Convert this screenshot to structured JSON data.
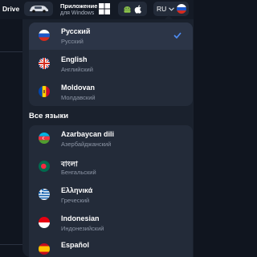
{
  "topbar": {
    "drive_label": "Drive",
    "app_title": "Приложение",
    "app_subtitle": "для Windows",
    "current_lang": "RU"
  },
  "top_languages": [
    {
      "name": "Русский",
      "native": "Русский",
      "flag": "ru-flag-icon",
      "selected": true
    },
    {
      "name": "English",
      "native": "Английский",
      "flag": "gb-flag-icon",
      "selected": false
    },
    {
      "name": "Moldovan",
      "native": "Молдавский",
      "flag": "md-flag-icon",
      "selected": false
    }
  ],
  "all_languages_title": "Все языки",
  "all_languages": [
    {
      "name": "Azarbaycan dili",
      "native": "Азербайджанский",
      "flag": "az-flag-icon"
    },
    {
      "name": "বাংলা",
      "native": "Бенгальский",
      "flag": "bd-flag-icon"
    },
    {
      "name": "Ελληνικά",
      "native": "Греческий",
      "flag": "gr-flag-icon"
    },
    {
      "name": "Indonesian",
      "native": "Индонезийский",
      "flag": "id-flag-icon"
    },
    {
      "name": "Español",
      "native": "",
      "flag": "es-flag-icon"
    }
  ],
  "colors": {
    "background": "#10151f",
    "panel": "#1a212d",
    "card": "#232b39",
    "selected_row": "#2c3547",
    "check": "#4f8ef7"
  }
}
